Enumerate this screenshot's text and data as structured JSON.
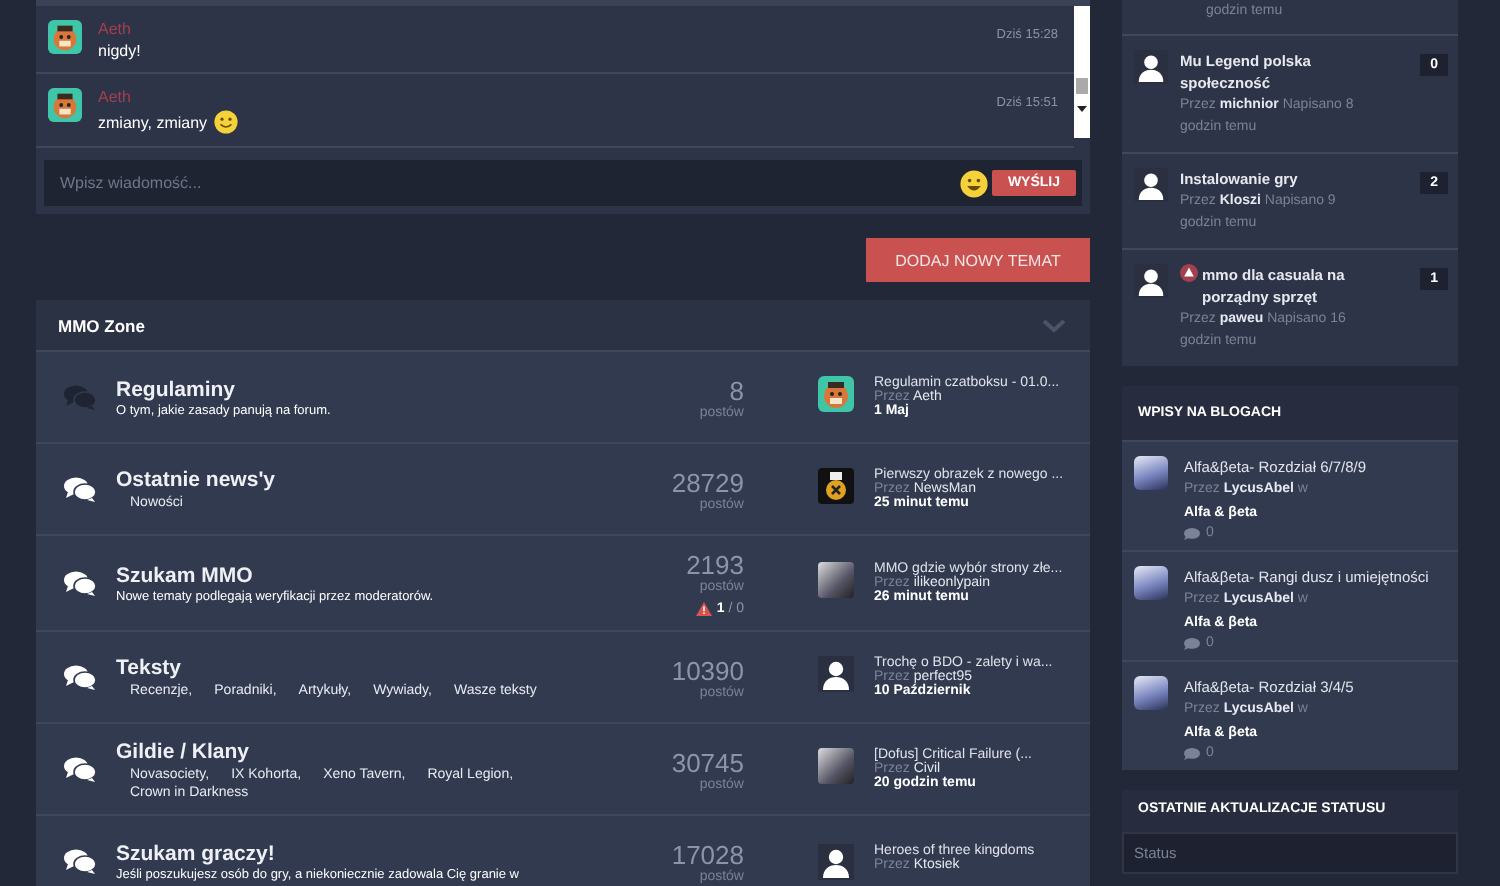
{
  "chat": {
    "messages": [
      {
        "author": "Aeth",
        "time": "Dziś 15:28",
        "text": "nigdy!",
        "emoji": false,
        "avatar": {
          "kind": "cartoon"
        }
      },
      {
        "author": "Aeth",
        "time": "Dziś 15:51",
        "text": "zmiany, zmiany",
        "emoji": true,
        "avatar": {
          "kind": "cartoon"
        }
      }
    ],
    "placeholder": "Wpisz wiadomość...",
    "send": "WYŚLIJ"
  },
  "new_topic_button": "DODAJ NOWY TEMAT",
  "forum": {
    "title": "MMO Zone",
    "rows": [
      {
        "title": "Regulaminy",
        "unread": false,
        "description": "O tym, jakie zasady panują na forum.",
        "count": "8",
        "count_label": "postów",
        "last_post": {
          "title": "Regulamin czatboksu - 01.0...",
          "by": "Przez **Aeth**",
          "date": "1 Maj",
          "avatar": {
            "kind": "cartoon"
          }
        }
      },
      {
        "title": "Ostatnie news'y",
        "unread": true,
        "subforums": [
          "Nowości"
        ],
        "count": "28729",
        "count_label": "postów",
        "last_post": {
          "title": "Pierwszy obrazek z nowego ...",
          "by": "Przez **NewsMan**",
          "date": "25 minut temu",
          "avatar": {
            "kind": "logo"
          }
        }
      },
      {
        "title": "Szukam MMO",
        "unread": true,
        "description": "Nowe tematy podlegają weryfikacji przez moderatorów.",
        "count": "2193",
        "count_label": "postów",
        "moderation": "**1** / 0",
        "last_post": {
          "title": "MMO gdzie wybór strony złe...",
          "by": "Przez **ilikeonlypain**",
          "date": "26 minut temu",
          "avatar": {
            "kind": "photo"
          }
        }
      },
      {
        "title": "Teksty",
        "unread": true,
        "subforums": [
          "Recenzje,",
          "Poradniki,",
          "Artykuły,",
          "Wywiady,",
          "Wasze teksty"
        ],
        "count": "10390",
        "count_label": "postów",
        "last_post": {
          "title": "Trochę o BDO - zalety i wa...",
          "by": "Przez **perfect95**",
          "date": "10 Październik",
          "avatar": {
            "kind": "silhouette"
          }
        }
      },
      {
        "title": "Gildie / Klany",
        "unread": true,
        "subforums": [
          "Novasociety,",
          "IX Kohorta,",
          "Xeno Tavern,",
          "Royal Legion,",
          "Crown in Darkness"
        ],
        "count": "30745",
        "count_label": "postów",
        "last_post": {
          "title": "[Dofus] Critical Failure (...",
          "by": "Przez **Civil**",
          "date": "20 godzin temu",
          "avatar": {
            "kind": "photo"
          }
        }
      },
      {
        "title": "Szukam graczy!",
        "unread": true,
        "description": "Jeśli poszukujesz osób do gry, a niekoniecznie zadowala Cię granie w",
        "count": "17028",
        "count_label": "postów",
        "last_post": {
          "title": "Heroes of three kingdoms",
          "by": "Przez **Ktosiek**",
          "avatar": {
            "kind": "silhouette"
          }
        }
      }
    ]
  },
  "sidebar": {
    "topics": [
      {
        "meta": "godzin temu"
      },
      {
        "title": "Mu Legend polska społeczność",
        "flagged": false,
        "meta": "Przez **michnior** Napisano 8 godzin temu",
        "replies": "0"
      },
      {
        "title": "Instalowanie gry",
        "flagged": false,
        "meta": "Przez **Kloszi** Napisano 9 godzin temu",
        "replies": "2"
      },
      {
        "title": "mmo dla casuala na porządny sprzęt",
        "flagged": true,
        "meta": "Przez **paweu** Napisano 16 godzin temu",
        "replies": "1"
      }
    ],
    "blogs": {
      "title": "WPISY NA BLOGACH",
      "entries": [
        {
          "title": "Alfa&βeta- Rozdział 6/7/8/9",
          "by": "Przez **LycusAbel** w",
          "blog": "Alfa & βeta",
          "comments": "0"
        },
        {
          "title": "Alfa&βeta- Rangi dusz i umiejętności",
          "by": "Przez **LycusAbel** w",
          "blog": "Alfa & βeta",
          "comments": "0"
        },
        {
          "title": "Alfa&βeta- Rozdział 3/4/5",
          "by": "Przez **LycusAbel** w",
          "blog": "Alfa & βeta",
          "comments": "0"
        }
      ]
    },
    "status": {
      "title": "OSTATNIE AKTUALIZACJE STATUSU",
      "placeholder": "Status"
    }
  }
}
